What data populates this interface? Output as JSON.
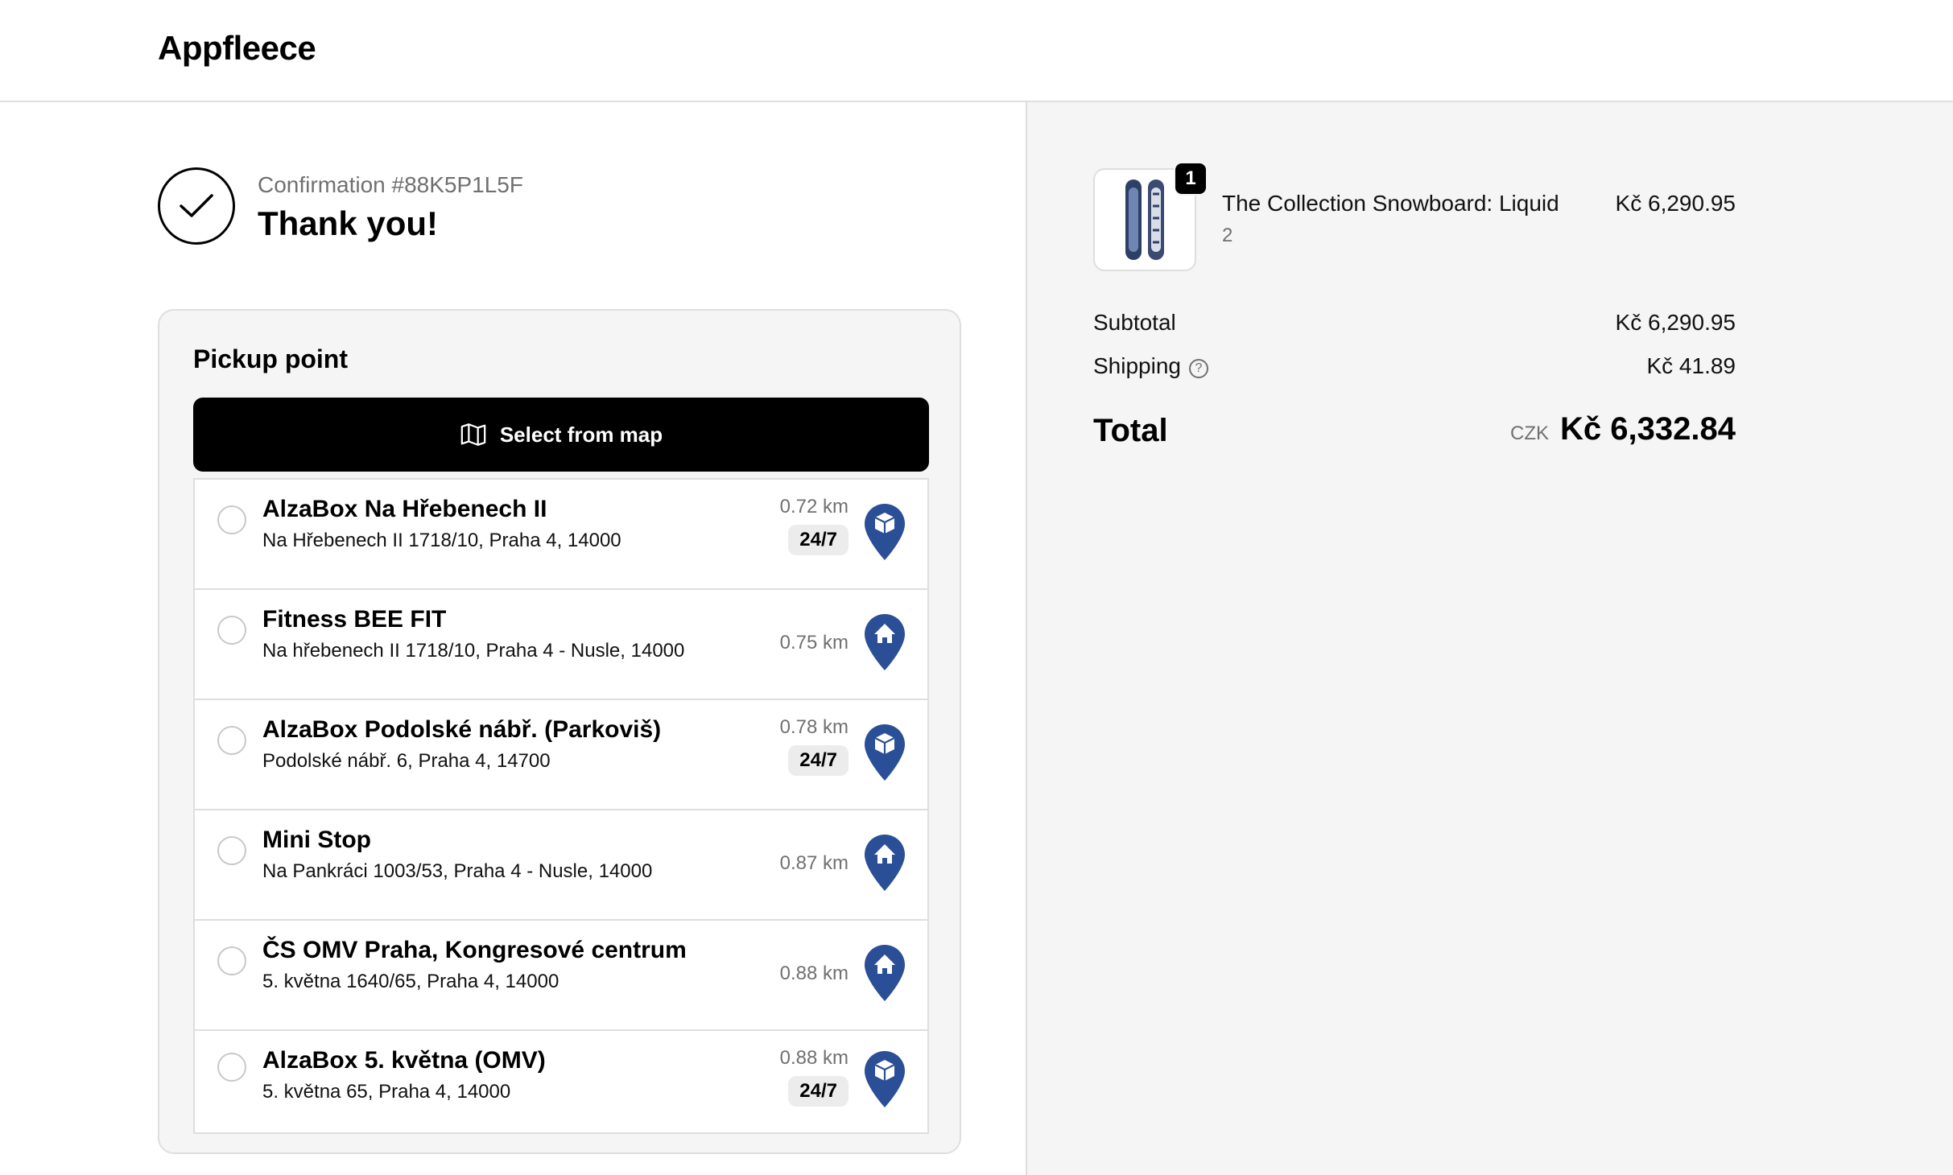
{
  "header": {
    "brand": "Appfleece"
  },
  "confirmation": {
    "number": "Confirmation #88K5P1L5F",
    "title": "Thank you!"
  },
  "pickup": {
    "title": "Pickup point",
    "map_button": "Select from map",
    "points": [
      {
        "name": "AlzaBox Na Hřebenech II",
        "address": "Na Hřebenech II 1718/10, Praha 4, 14000",
        "distance": "0.72 km",
        "hours": "24/7",
        "icon": "box-pin-icon"
      },
      {
        "name": "Fitness BEE FIT",
        "address": "Na hřebenech II 1718/10, Praha 4 - Nusle, 14000",
        "distance": "0.75 km",
        "hours": "",
        "icon": "home-pin-icon"
      },
      {
        "name": "AlzaBox Podolské nábř. (Parkoviš)",
        "address": "Podolské nábř. 6, Praha 4, 14700",
        "distance": "0.78 km",
        "hours": "24/7",
        "icon": "box-pin-icon"
      },
      {
        "name": "Mini Stop",
        "address": "Na Pankráci 1003/53, Praha 4 - Nusle, 14000",
        "distance": "0.87 km",
        "hours": "",
        "icon": "home-pin-icon"
      },
      {
        "name": "ČS OMV Praha, Kongresové centrum",
        "address": "5. května 1640/65, Praha 4, 14000",
        "distance": "0.88 km",
        "hours": "",
        "icon": "home-pin-icon"
      },
      {
        "name": "AlzaBox 5. května (OMV)",
        "address": "5. května 65, Praha 4, 14000",
        "distance": "0.88 km",
        "hours": "24/7",
        "icon": "box-pin-icon"
      }
    ]
  },
  "order": {
    "product_name": "The Collection Snowboard: Liquid",
    "product_variant": "2",
    "quantity": "1",
    "product_price": "Kč 6,290.95",
    "subtotal_label": "Subtotal",
    "subtotal": "Kč 6,290.95",
    "shipping_label": "Shipping",
    "shipping": "Kč 41.89",
    "total_label": "Total",
    "currency": "CZK",
    "total": "Kč 6,332.84"
  },
  "colors": {
    "pin": "#2b4f96",
    "button": "#000000",
    "sidebar_bg": "#f5f5f5"
  }
}
